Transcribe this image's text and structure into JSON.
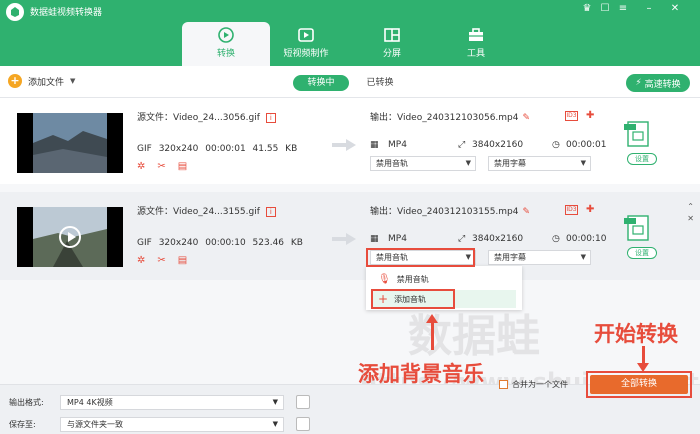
{
  "app": {
    "title": "数据蛙视频转换器"
  },
  "nav": {
    "tabs": [
      {
        "label": "转换",
        "active": true
      },
      {
        "label": "短视频制作",
        "active": false
      },
      {
        "label": "分屏",
        "active": false
      },
      {
        "label": "工具",
        "active": false
      }
    ]
  },
  "toolbar": {
    "add_file": "添加文件",
    "tab_converting": "转换中",
    "tab_converted": "已转换",
    "fast_convert": "高速转换"
  },
  "files": [
    {
      "source": "源文件：Video_24...3056.gif",
      "format": "GIF",
      "resolution": "320x240",
      "duration": "00:00:01",
      "size": "41.55 KB",
      "output": "输出：Video_240312103056.mp4",
      "out_format": "MP4",
      "out_resolution": "3840x2160",
      "out_duration": "00:00:01",
      "audio": "禁用音轨",
      "subtitle": "禁用字幕",
      "settings": "设置"
    },
    {
      "source": "源文件：Video_24...3155.gif",
      "format": "GIF",
      "resolution": "320x240",
      "duration": "00:00:10",
      "size": "523.46 KB",
      "output": "输出：Video_240312103155.mp4",
      "out_format": "MP4",
      "out_resolution": "3840x2160",
      "out_duration": "00:00:10",
      "audio": "禁用音轨",
      "subtitle": "禁用字幕",
      "settings": "设置"
    }
  ],
  "audio_menu": {
    "items": [
      "禁用音轨",
      "添加音轨"
    ]
  },
  "annotations": {
    "add_bg_music": "添加背景音乐",
    "start_convert": "开始转换"
  },
  "watermark": {
    "text1": "数据蛙",
    "text2": "https://www.shujuwa.net"
  },
  "bottom": {
    "output_format_label": "输出格式:",
    "output_format_value": "MP4 4K视频",
    "save_to_label": "保存至:",
    "save_to_value": "与源文件夹一致",
    "merge_label": "合并为一个文件",
    "convert_all": "全部转换"
  },
  "colors": {
    "brand": "#2fb16f",
    "accent": "#e86a2c",
    "annotation": "#e74c3c"
  }
}
